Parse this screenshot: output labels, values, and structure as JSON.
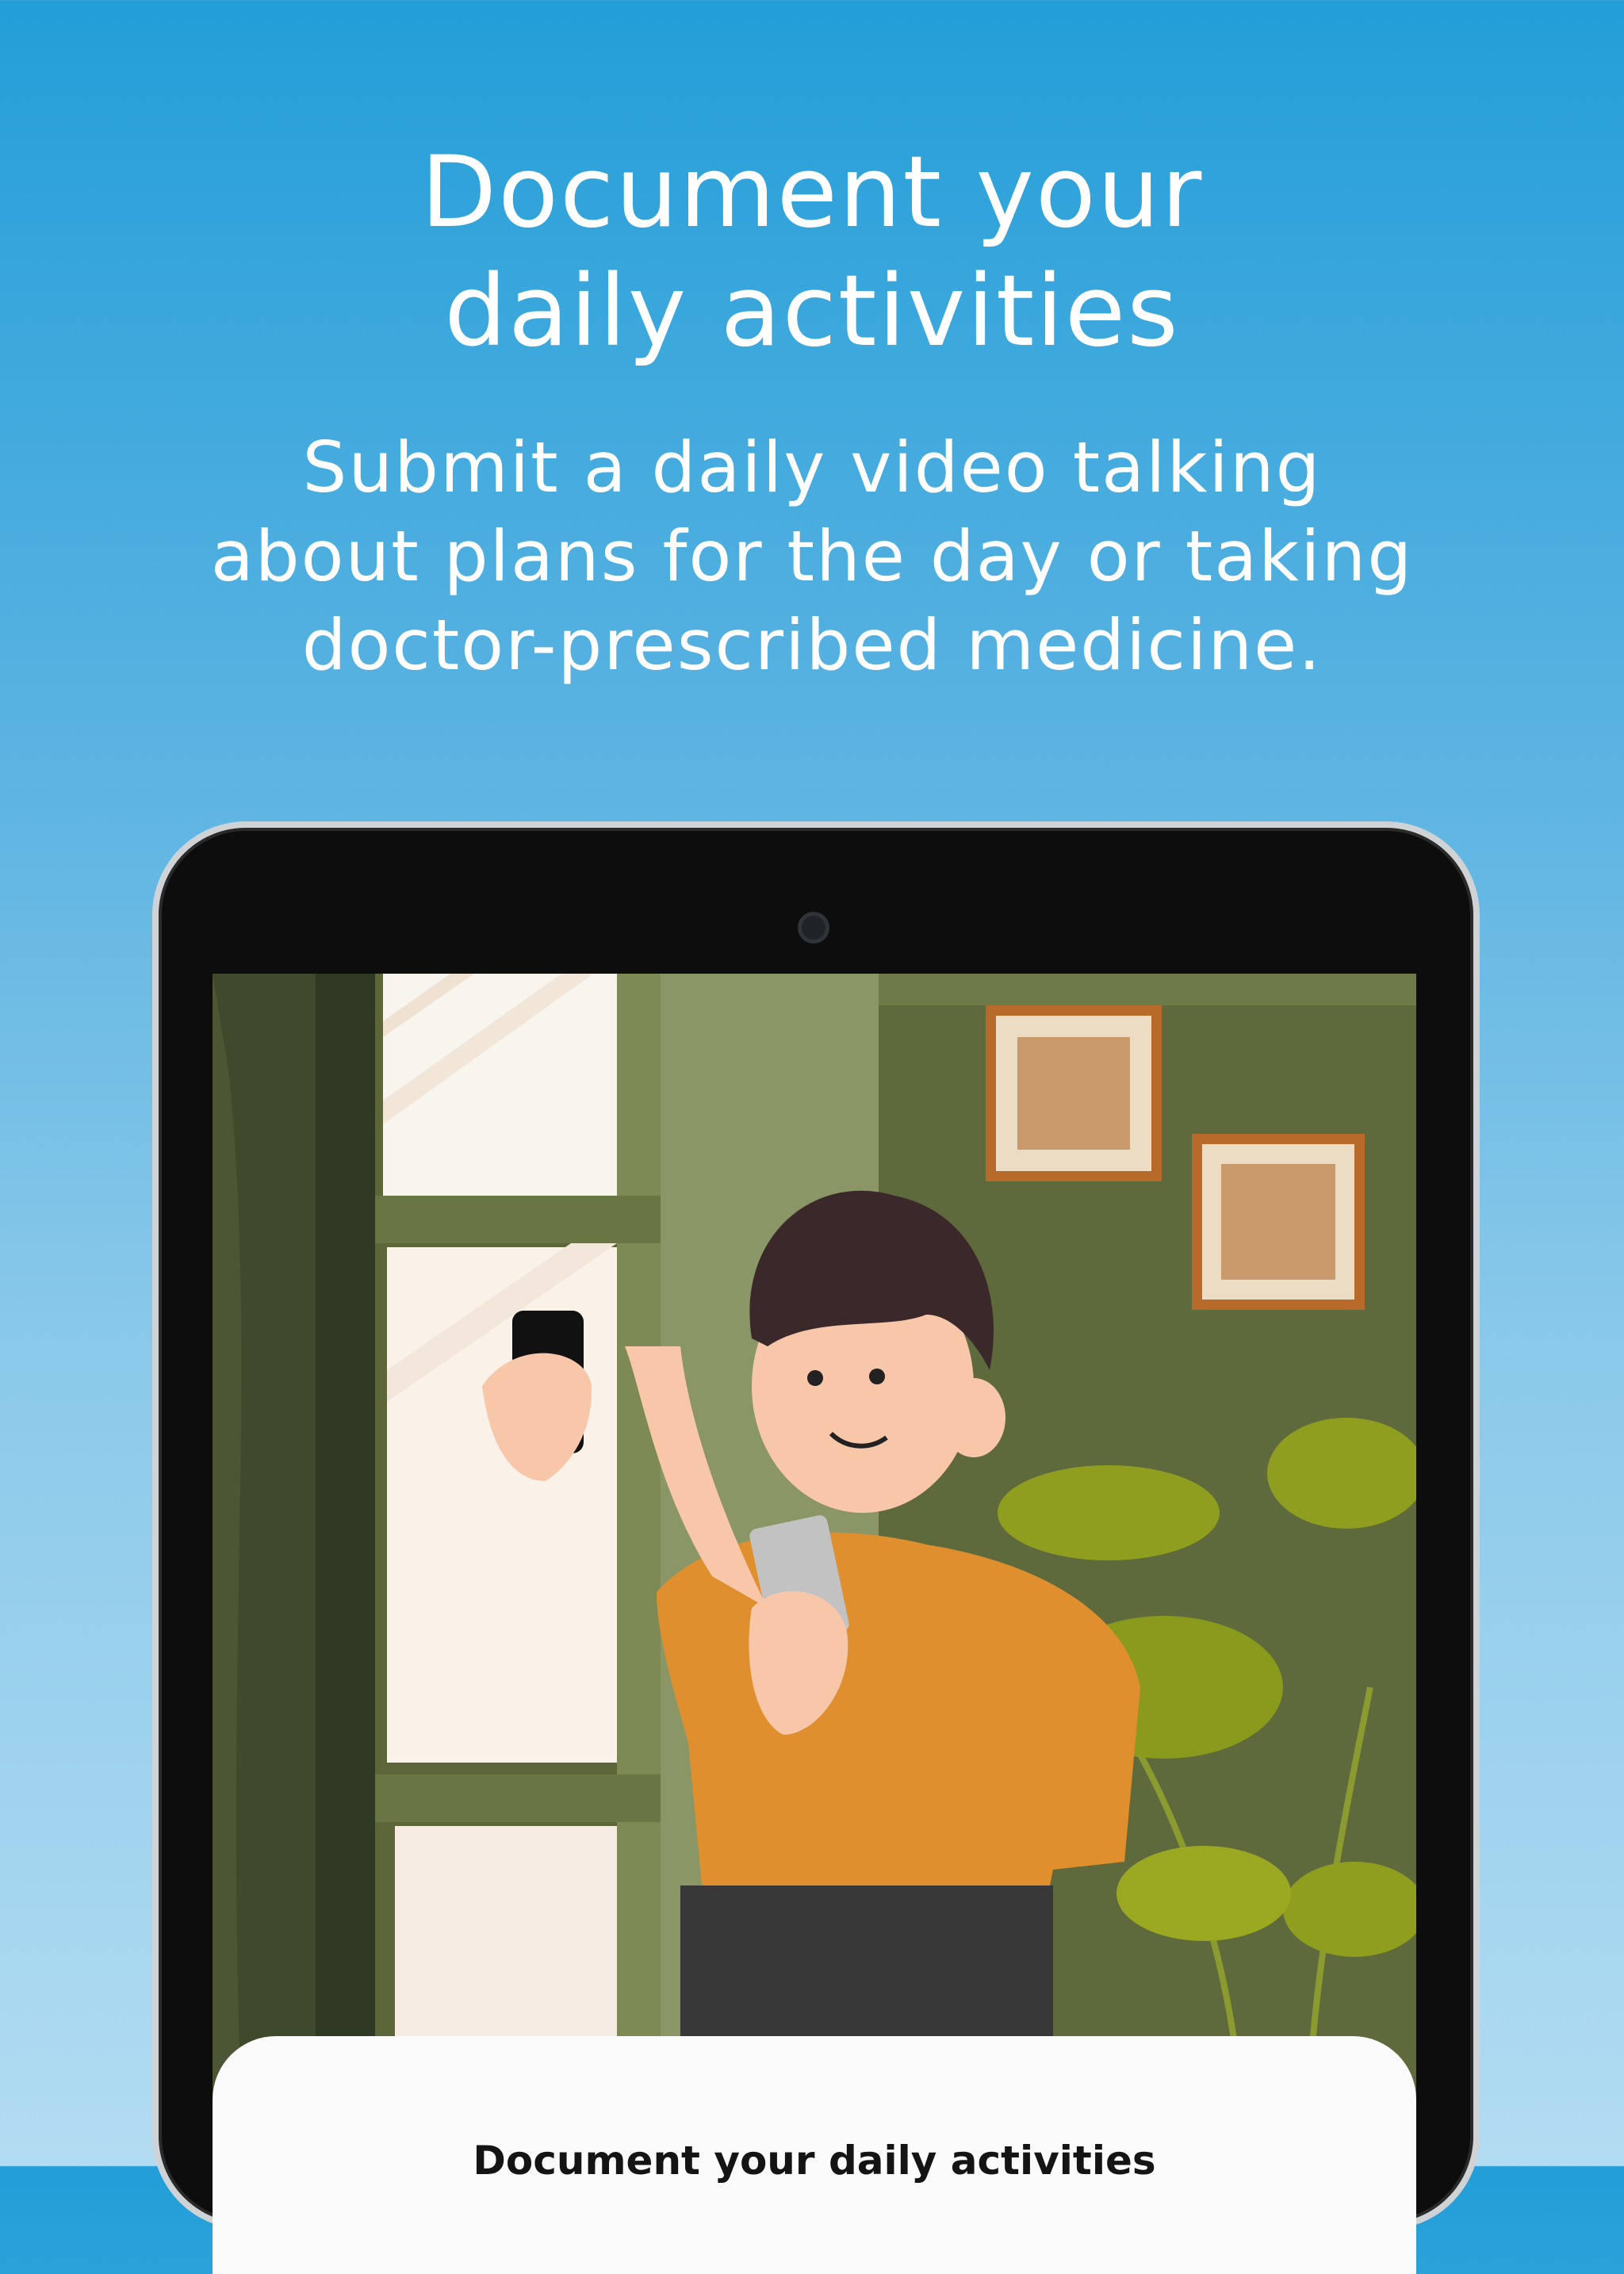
{
  "hero": {
    "title_lines": [
      "Document your",
      "daily activities"
    ],
    "subtitle_lines": [
      "Submit a daily video talking",
      "about plans for the day or taking",
      "doctor-prescribed medicine."
    ]
  },
  "app_screen": {
    "card_title": "Document your daily activities"
  },
  "colors": {
    "background_top": "#239ed8",
    "background_bottom": "#b2dcf2",
    "text": "#ffffff",
    "device_frame": "#0d0d0d"
  }
}
